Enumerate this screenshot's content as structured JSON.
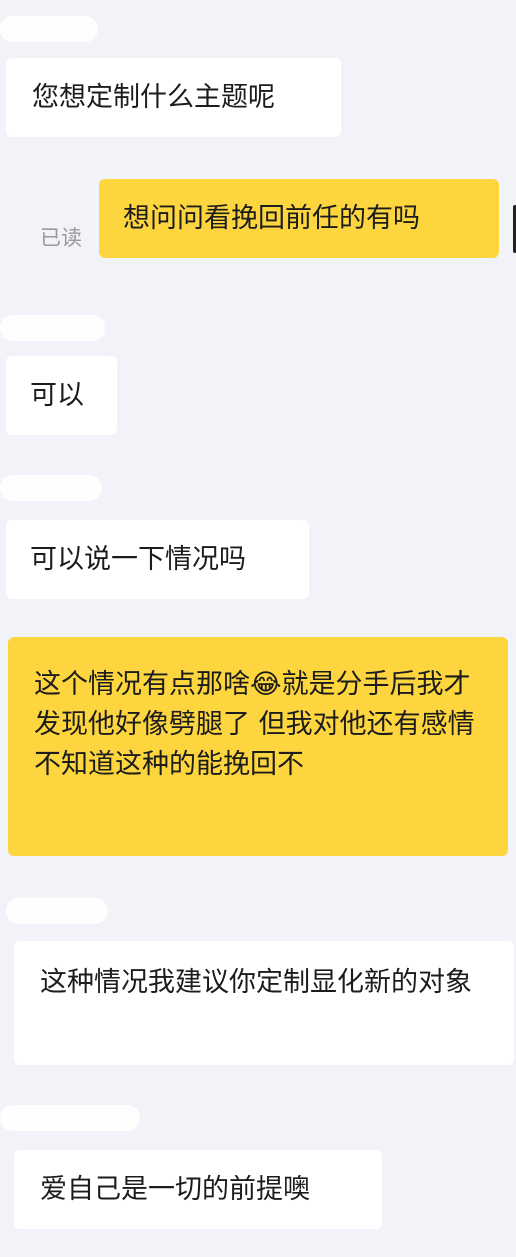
{
  "chat": {
    "messages": [
      {
        "direction": "incoming",
        "text": "您想定制什么主题呢"
      },
      {
        "direction": "outgoing",
        "text": "想问问看挽回前任的有吗",
        "status": "已读"
      },
      {
        "direction": "incoming",
        "text": "可以"
      },
      {
        "direction": "incoming",
        "text": "可以说一下情况吗"
      },
      {
        "direction": "outgoing",
        "text": "这个情况有点那啥😂就是分手后我才发现他好像劈腿了 但我对他还有感情 不知道这种的能挽回不"
      },
      {
        "direction": "incoming",
        "text": "这种情况我建议你定制显化新的对象"
      },
      {
        "direction": "incoming",
        "text": "爱自己是一切的前提噢"
      }
    ]
  },
  "colors": {
    "background": "#f2f3f8",
    "incoming_bubble": "#ffffff",
    "outgoing_bubble": "#fdd63f",
    "read_status": "#9a9a9a"
  }
}
